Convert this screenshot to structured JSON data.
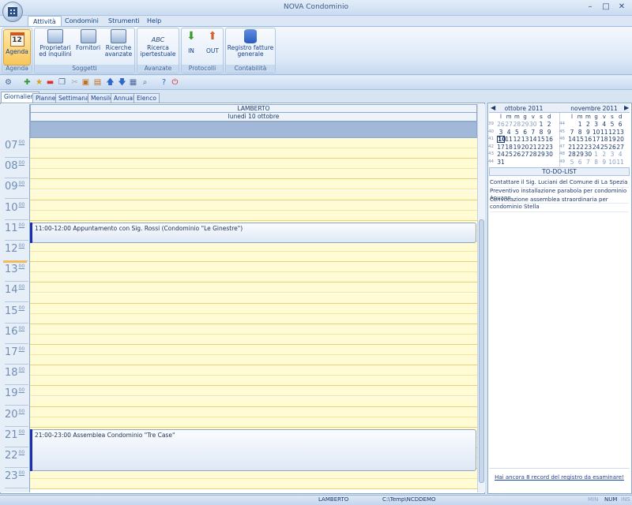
{
  "window": {
    "title": "NOVA Condominio"
  },
  "ribbon_tabs": [
    "Attività",
    "Condomini",
    "Strumenti",
    "Help"
  ],
  "ribbon": {
    "groups": [
      {
        "label": "Agenda",
        "buttons": [
          "Agenda"
        ]
      },
      {
        "label": "Soggetti",
        "buttons": [
          "Proprietari ed inquilini",
          "Fornitori",
          "Ricerche avanzate"
        ]
      },
      {
        "label": "Avanzate",
        "buttons": [
          "Ricerca ipertestuale"
        ]
      },
      {
        "label": "Protocolli",
        "buttons": [
          "IN",
          "OUT"
        ]
      },
      {
        "label": "Contabilità",
        "buttons": [
          "Registro fatture generale"
        ]
      }
    ]
  },
  "view_tabs": [
    "Giornaliera",
    "Planner",
    "Settimanale",
    "Mensile",
    "Annuale",
    "Elenco"
  ],
  "calendar": {
    "resource": "LAMBERTO",
    "day_header": "lunedì 10 ottobre",
    "hours": [
      "07",
      "08",
      "09",
      "10",
      "11",
      "12",
      "13",
      "14",
      "15",
      "16",
      "17",
      "18",
      "19",
      "20",
      "21",
      "22",
      "23"
    ],
    "minutes": "00",
    "appointments": [
      {
        "text": "11:00-12:00 Appuntamento con Sig. Rossi (Condominio \"Le Ginestre\")"
      },
      {
        "text": "21:00-23:00 Assemblea Condominio \"Tre Case\""
      }
    ]
  },
  "minical": {
    "months": [
      "ottobre 2011",
      "novembre 2011"
    ],
    "weekdays": [
      "l",
      "m",
      "m",
      "g",
      "v",
      "s",
      "d"
    ],
    "oct_weeks": [
      {
        "wk": "39",
        "days": [
          "26",
          "27",
          "28",
          "29",
          "30",
          "1",
          "2"
        ]
      },
      {
        "wk": "40",
        "days": [
          "3",
          "4",
          "5",
          "6",
          "7",
          "8",
          "9"
        ]
      },
      {
        "wk": "41",
        "days": [
          "10",
          "11",
          "12",
          "13",
          "14",
          "15",
          "16"
        ]
      },
      {
        "wk": "42",
        "days": [
          "17",
          "18",
          "19",
          "20",
          "21",
          "22",
          "23"
        ]
      },
      {
        "wk": "43",
        "days": [
          "24",
          "25",
          "26",
          "27",
          "28",
          "29",
          "30"
        ]
      },
      {
        "wk": "44",
        "days": [
          "31"
        ]
      }
    ],
    "nov_weeks": [
      {
        "wk": "44",
        "days": [
          "",
          "1",
          "2",
          "3",
          "4",
          "5",
          "6"
        ]
      },
      {
        "wk": "45",
        "days": [
          "7",
          "8",
          "9",
          "10",
          "11",
          "12",
          "13"
        ]
      },
      {
        "wk": "46",
        "days": [
          "14",
          "15",
          "16",
          "17",
          "18",
          "19",
          "20"
        ]
      },
      {
        "wk": "47",
        "days": [
          "21",
          "22",
          "23",
          "24",
          "25",
          "26",
          "27"
        ]
      },
      {
        "wk": "48",
        "days": [
          "28",
          "29",
          "30",
          "1",
          "2",
          "3",
          "4"
        ]
      },
      {
        "wk": "49",
        "days": [
          "5",
          "6",
          "7",
          "8",
          "9",
          "10",
          "11"
        ]
      }
    ],
    "today": "10"
  },
  "todo": {
    "header": "TO-DO-LIST",
    "items": [
      "Contattare il Sig. Luciani del Comune di La Spezia",
      "Preventivo installazione parabola per condominio Apuano",
      "Convocazione assemblea straordinaria per condominio Stella"
    ],
    "footer_link": "Hai ancora 8 record del registro da esaminare!"
  },
  "status": {
    "user": "LAMBERTO",
    "path": "C:\\Temp\\NCDDEMO",
    "keys": [
      "MIN",
      "NUM",
      "INS"
    ]
  }
}
